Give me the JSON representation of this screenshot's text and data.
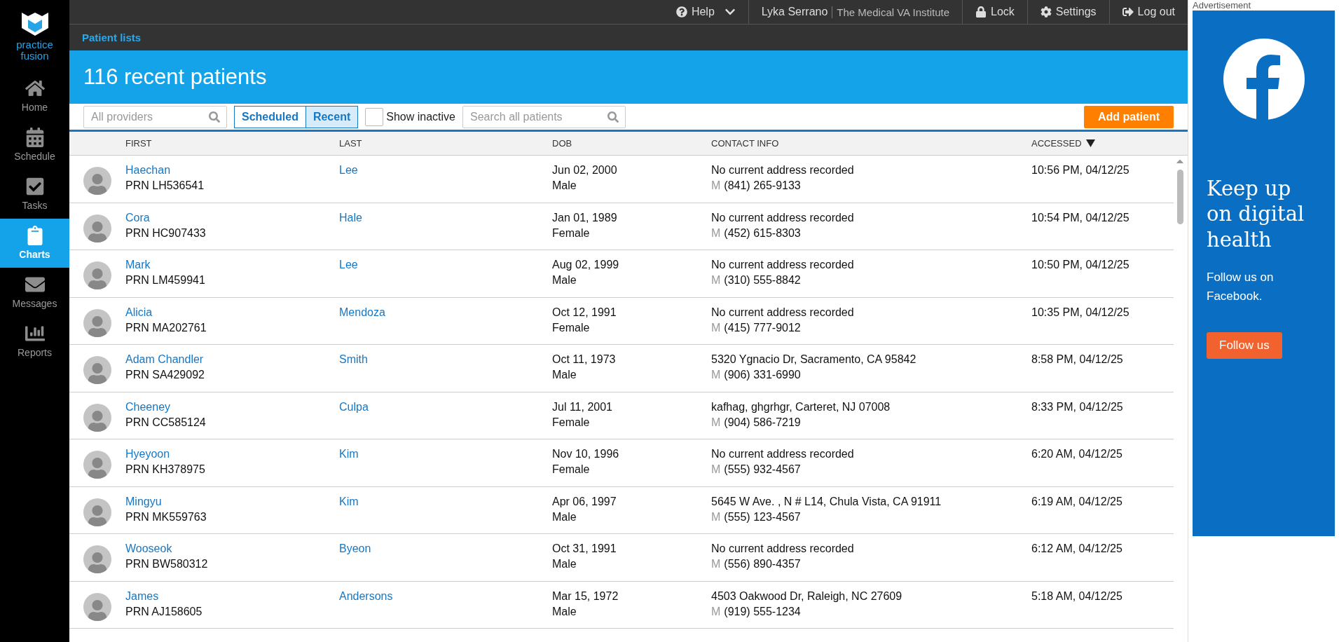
{
  "sidebar": {
    "logo_text": "practice fusion",
    "items": [
      {
        "kind": "home",
        "label": "Home",
        "selected": false
      },
      {
        "kind": "schedule",
        "label": "Schedule",
        "selected": false
      },
      {
        "kind": "tasks",
        "label": "Tasks",
        "selected": false
      },
      {
        "kind": "charts",
        "label": "Charts",
        "selected": true
      },
      {
        "kind": "messages",
        "label": "Messages",
        "selected": false
      },
      {
        "kind": "reports",
        "label": "Reports",
        "selected": false
      }
    ]
  },
  "topbar": {
    "help": "Help",
    "user": "Lyka Serrano",
    "org": "The Medical VA Institute",
    "lock": "Lock",
    "settings": "Settings",
    "logout": "Log out"
  },
  "subnav": {
    "tab": "Patient lists"
  },
  "header": {
    "title": "116 recent patients"
  },
  "toolbar": {
    "provider_placeholder": "All providers",
    "toggle": [
      {
        "label": "Scheduled",
        "selected": false
      },
      {
        "label": "Recent",
        "selected": true
      }
    ],
    "show_inactive": {
      "label": "Show inactive",
      "checked": false
    },
    "search_placeholder": "Search all patients",
    "add_button": "Add patient"
  },
  "table": {
    "columns": [
      "FIRST",
      "LAST",
      "DOB",
      "CONTACT INFO",
      "ACCESSED"
    ],
    "rows": [
      {
        "first": "Haechan",
        "prn": "PRN LH536541",
        "last": "Lee",
        "dob": "Jun 02, 2000",
        "sex": "Male",
        "address": "No current address recorded",
        "phone_type": "M",
        "phone": "(841) 265-9133",
        "accessed": "10:56 PM, 04/12/25"
      },
      {
        "first": "Cora",
        "prn": "PRN HC907433",
        "last": "Hale",
        "dob": "Jan 01, 1989",
        "sex": "Female",
        "address": "No current address recorded",
        "phone_type": "M",
        "phone": "(452) 615-8303",
        "accessed": "10:54 PM, 04/12/25"
      },
      {
        "first": "Mark",
        "prn": "PRN LM459941",
        "last": "Lee",
        "dob": "Aug 02, 1999",
        "sex": "Male",
        "address": "No current address recorded",
        "phone_type": "M",
        "phone": "(310) 555-8842",
        "accessed": "10:50 PM, 04/12/25"
      },
      {
        "first": "Alicia",
        "prn": "PRN MA202761",
        "last": "Mendoza",
        "dob": "Oct 12, 1991",
        "sex": "Female",
        "address": "No current address recorded",
        "phone_type": "M",
        "phone": "(415) 777-9012",
        "accessed": "10:35 PM, 04/12/25"
      },
      {
        "first": "Adam Chandler",
        "prn": "PRN SA429092",
        "last": "Smith",
        "dob": "Oct 11, 1973",
        "sex": "Male",
        "address": "5320 Ygnacio Dr, Sacramento, CA 95842",
        "phone_type": "M",
        "phone": "(906) 331-6990",
        "accessed": "8:58 PM, 04/12/25"
      },
      {
        "first": "Cheeney",
        "prn": "PRN CC585124",
        "last": "Culpa",
        "dob": "Jul 11, 2001",
        "sex": "Female",
        "address": "kafhag, ghgrhgr, Carteret, NJ 07008",
        "phone_type": "M",
        "phone": "(904) 586-7219",
        "accessed": "8:33 PM, 04/12/25"
      },
      {
        "first": "Hyeyoon",
        "prn": "PRN KH378975",
        "last": "Kim",
        "dob": "Nov 10, 1996",
        "sex": "Female",
        "address": "No current address recorded",
        "phone_type": "M",
        "phone": "(555) 932-4567",
        "accessed": "6:20 AM, 04/12/25"
      },
      {
        "first": "Mingyu",
        "prn": "PRN MK559763",
        "last": "Kim",
        "dob": "Apr 06, 1997",
        "sex": "Male",
        "address": "5645 W Ave. , N # L14, Chula Vista, CA 91911",
        "phone_type": "M",
        "phone": "(555) 123-4567",
        "accessed": "6:19 AM, 04/12/25"
      },
      {
        "first": "Wooseok",
        "prn": "PRN BW580312",
        "last": "Byeon",
        "dob": "Oct 31, 1991",
        "sex": "Male",
        "address": "No current address recorded",
        "phone_type": "M",
        "phone": "(556) 890-4357",
        "accessed": "6:12 AM, 04/12/25"
      },
      {
        "first": "James",
        "prn": "PRN AJ158605",
        "last": "Andersons",
        "dob": "Mar 15, 1972",
        "sex": "Male",
        "address": "4503 Oakwood Dr, Raleigh, NC 27609",
        "phone_type": "M",
        "phone": "(919) 555-1234",
        "accessed": "5:18 AM, 04/12/25"
      }
    ]
  },
  "ad": {
    "label": "Advertisement",
    "headline": "Keep up on digital health",
    "body": "Follow us on Facebook.",
    "button": "Follow us"
  }
}
